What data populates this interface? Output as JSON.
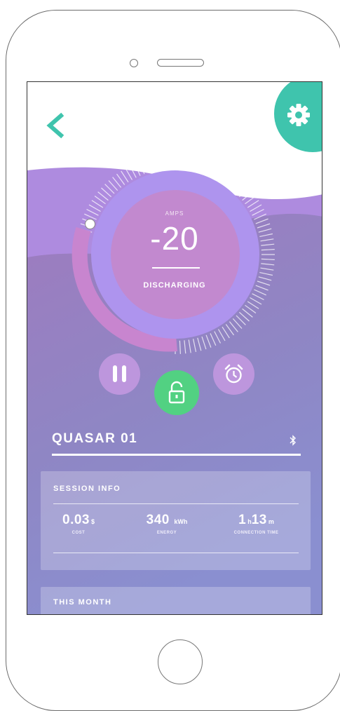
{
  "gauge": {
    "label": "AMPS",
    "value": "-20",
    "state": "DISCHARGING"
  },
  "device": {
    "name": "QUASAR 01"
  },
  "session": {
    "title": "SESSION INFO",
    "cost": {
      "value": "0.03",
      "unit": "$",
      "caption": "COST"
    },
    "energy": {
      "value": "340",
      "unit": "kWh",
      "caption": "ENERGY"
    },
    "connection": {
      "hours": "1",
      "hours_unit": "h",
      "minutes": "13",
      "minutes_unit": "m",
      "caption": "CONNECTION TIME"
    }
  },
  "month": {
    "title": "THIS MONTH"
  },
  "colors": {
    "accent_teal": "#3fc4ad",
    "lock_green": "#52d182",
    "button_purple": "#bd96dd",
    "wave_purple": "#ae8bdf"
  },
  "icons": [
    "back-icon",
    "settings-gear-icon",
    "pause-icon",
    "unlock-icon",
    "alarm-clock-icon",
    "bluetooth-icon"
  ]
}
